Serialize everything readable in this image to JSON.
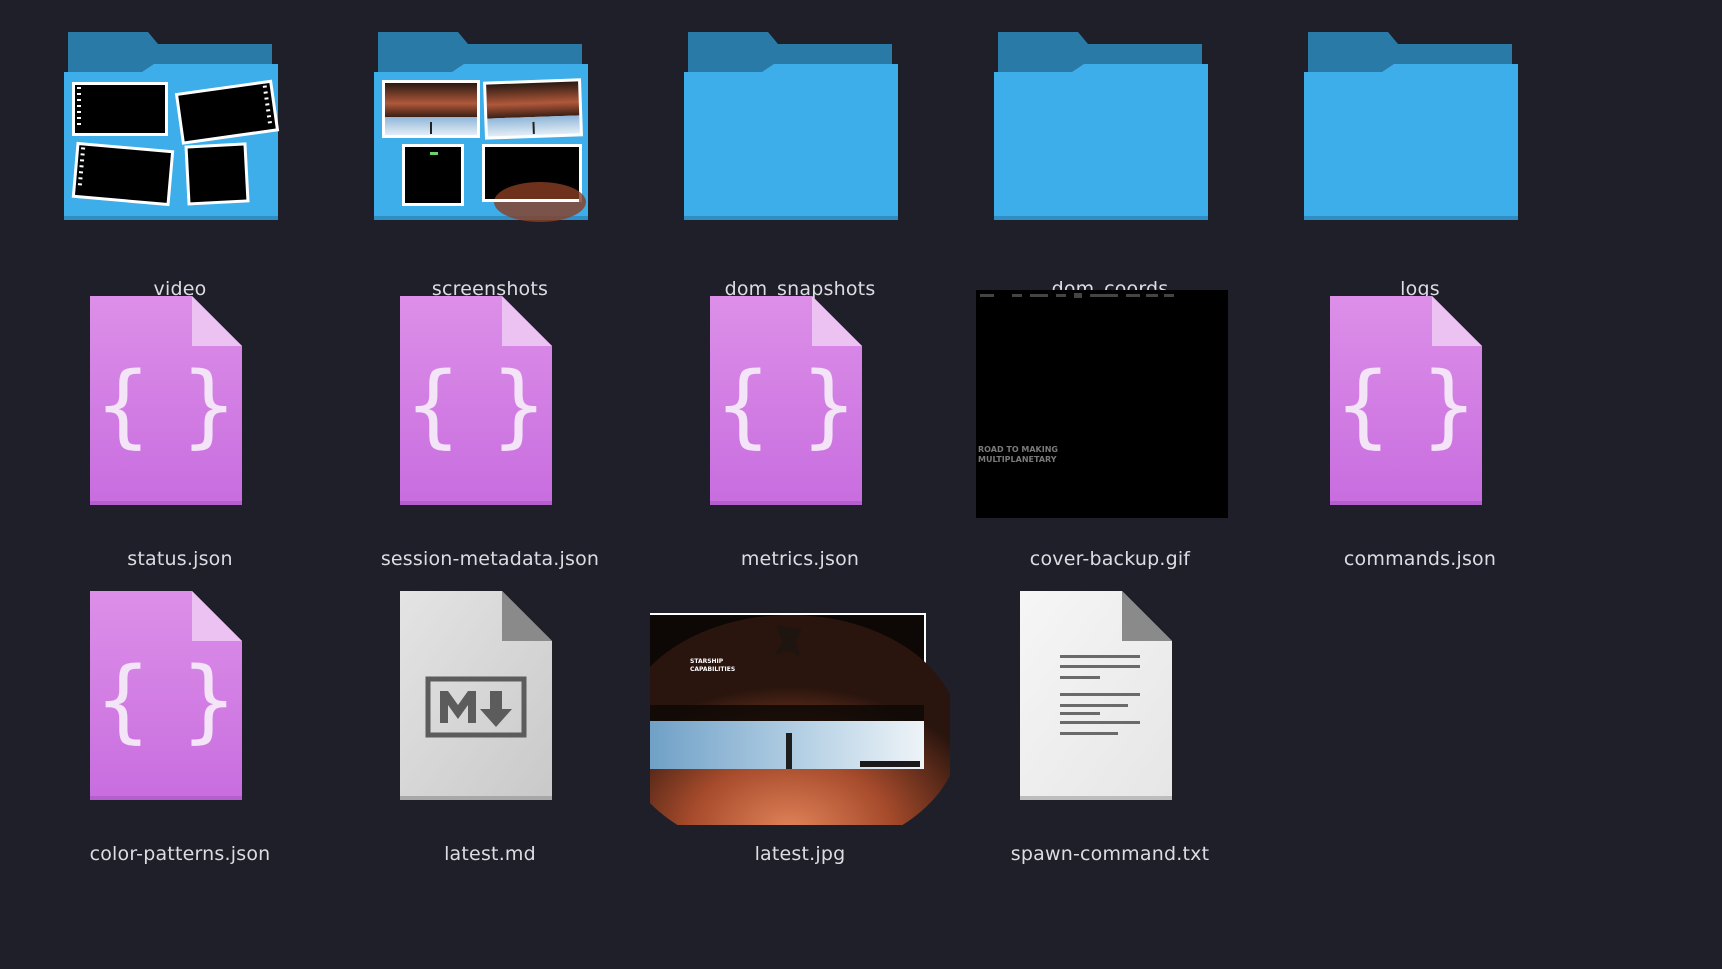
{
  "colors": {
    "background": "#1f1f29",
    "folder_front": "#3daee9",
    "folder_back": "#2a7aa8",
    "json_icon": "#d88ae6",
    "label_text": "#dcdce2"
  },
  "items": [
    {
      "name": "video",
      "icon": "folder-with-video-thumbnails-icon"
    },
    {
      "name": "screenshots",
      "icon": "folder-with-image-thumbnails-icon"
    },
    {
      "name": "dom_snapshots",
      "icon": "folder-icon"
    },
    {
      "name": "dom_coords",
      "icon": "folder-icon"
    },
    {
      "name": "logs",
      "icon": "folder-icon"
    },
    {
      "name": "status.json",
      "icon": "json-file-icon"
    },
    {
      "name": "session-metadata.json",
      "icon": "json-file-icon"
    },
    {
      "name": "metrics.json",
      "icon": "json-file-icon"
    },
    {
      "name": "cover-backup.gif",
      "icon": "gif-thumbnail-icon"
    },
    {
      "name": "commands.json",
      "icon": "json-file-icon"
    },
    {
      "name": "color-patterns.json",
      "icon": "json-file-icon"
    },
    {
      "name": "latest.md",
      "icon": "markdown-file-icon"
    },
    {
      "name": "latest.jpg",
      "icon": "jpg-thumbnail-icon"
    },
    {
      "name": "spawn-command.txt",
      "icon": "text-file-icon"
    }
  ],
  "thumb_text": {
    "gif_line1": "ROAD TO MAKING",
    "gif_line2": "MULTIPLANETARY",
    "jpg_line1": "STARSHIP",
    "jpg_line2": "CAPABILITIES"
  }
}
